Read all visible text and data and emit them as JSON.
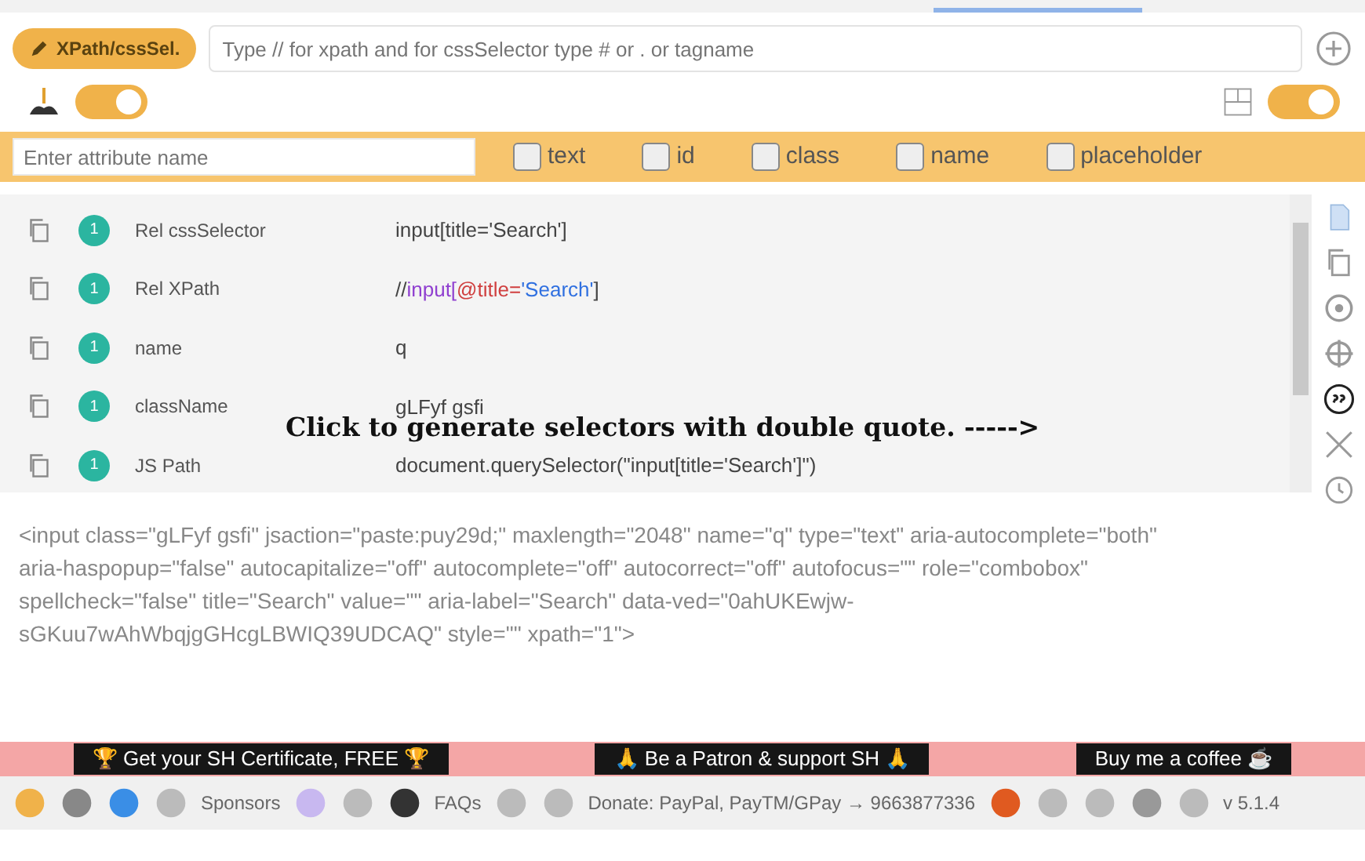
{
  "selector_bar": {
    "mode_button": "XPath/cssSel.",
    "placeholder": "Type // for xpath and for cssSelector type # or . or tagname"
  },
  "toggles": [
    {
      "kind": "plant",
      "on": true
    },
    {
      "kind": "layout",
      "on": true
    }
  ],
  "attribute_bar": {
    "placeholder": "Enter attribute name",
    "options": [
      {
        "label": "text",
        "checked": false
      },
      {
        "label": "id",
        "checked": false
      },
      {
        "label": "class",
        "checked": false
      },
      {
        "label": "name",
        "checked": false
      },
      {
        "label": "placeholder",
        "checked": false
      }
    ]
  },
  "selectors": [
    {
      "count": "1",
      "name": "Rel cssSelector",
      "value": "input[title='Search']",
      "kind": "plain"
    },
    {
      "count": "1",
      "name": "Rel XPath",
      "value": "//input[@title='Search']",
      "kind": "xpath"
    },
    {
      "count": "1",
      "name": "name",
      "value": "q",
      "kind": "plain"
    },
    {
      "count": "1",
      "name": "className",
      "value": "gLFyf gsfi",
      "kind": "plain"
    },
    {
      "count": "1",
      "name": "JS Path",
      "value": "document.querySelector(\"input[title='Search']\")",
      "kind": "plain"
    }
  ],
  "annotation": "Click to generate selectors with double quote. ----->",
  "html_snippet": "<input class=\"gLFyf gsfi\" jsaction=\"paste:puy29d;\" maxlength=\"2048\" name=\"q\" type=\"text\" aria-autocomplete=\"both\" aria-haspopup=\"false\" autocapitalize=\"off\" autocomplete=\"off\" autocorrect=\"off\" autofocus=\"\" role=\"combobox\" spellcheck=\"false\" title=\"Search\" value=\"\" aria-label=\"Search\" data-ved=\"0ahUKEwjw-sGKuu7wAhWbqjgGHcgLBWIQ39UDCAQ\" style=\"\" xpath=\"1\">",
  "banners": [
    "🏆 Get your SH Certificate, FREE 🏆",
    "🙏 Be a Patron & support SH 🙏",
    "Buy me a coffee ☕"
  ],
  "footer": [
    {
      "kind": "icon"
    },
    {
      "kind": "icon"
    },
    {
      "kind": "icon"
    },
    {
      "kind": "icon"
    },
    {
      "kind": "text",
      "text": "Sponsors"
    },
    {
      "kind": "icon"
    },
    {
      "kind": "icon"
    },
    {
      "kind": "icon"
    },
    {
      "kind": "text",
      "text": "FAQs"
    },
    {
      "kind": "icon"
    },
    {
      "kind": "icon"
    },
    {
      "kind": "text",
      "text": "Donate: PayPal, PayTM/GPay → 9663877336"
    },
    {
      "kind": "icon"
    },
    {
      "kind": "icon"
    },
    {
      "kind": "icon"
    },
    {
      "kind": "icon"
    },
    {
      "kind": "icon"
    },
    {
      "kind": "text",
      "text": "v 5.1.4"
    }
  ]
}
